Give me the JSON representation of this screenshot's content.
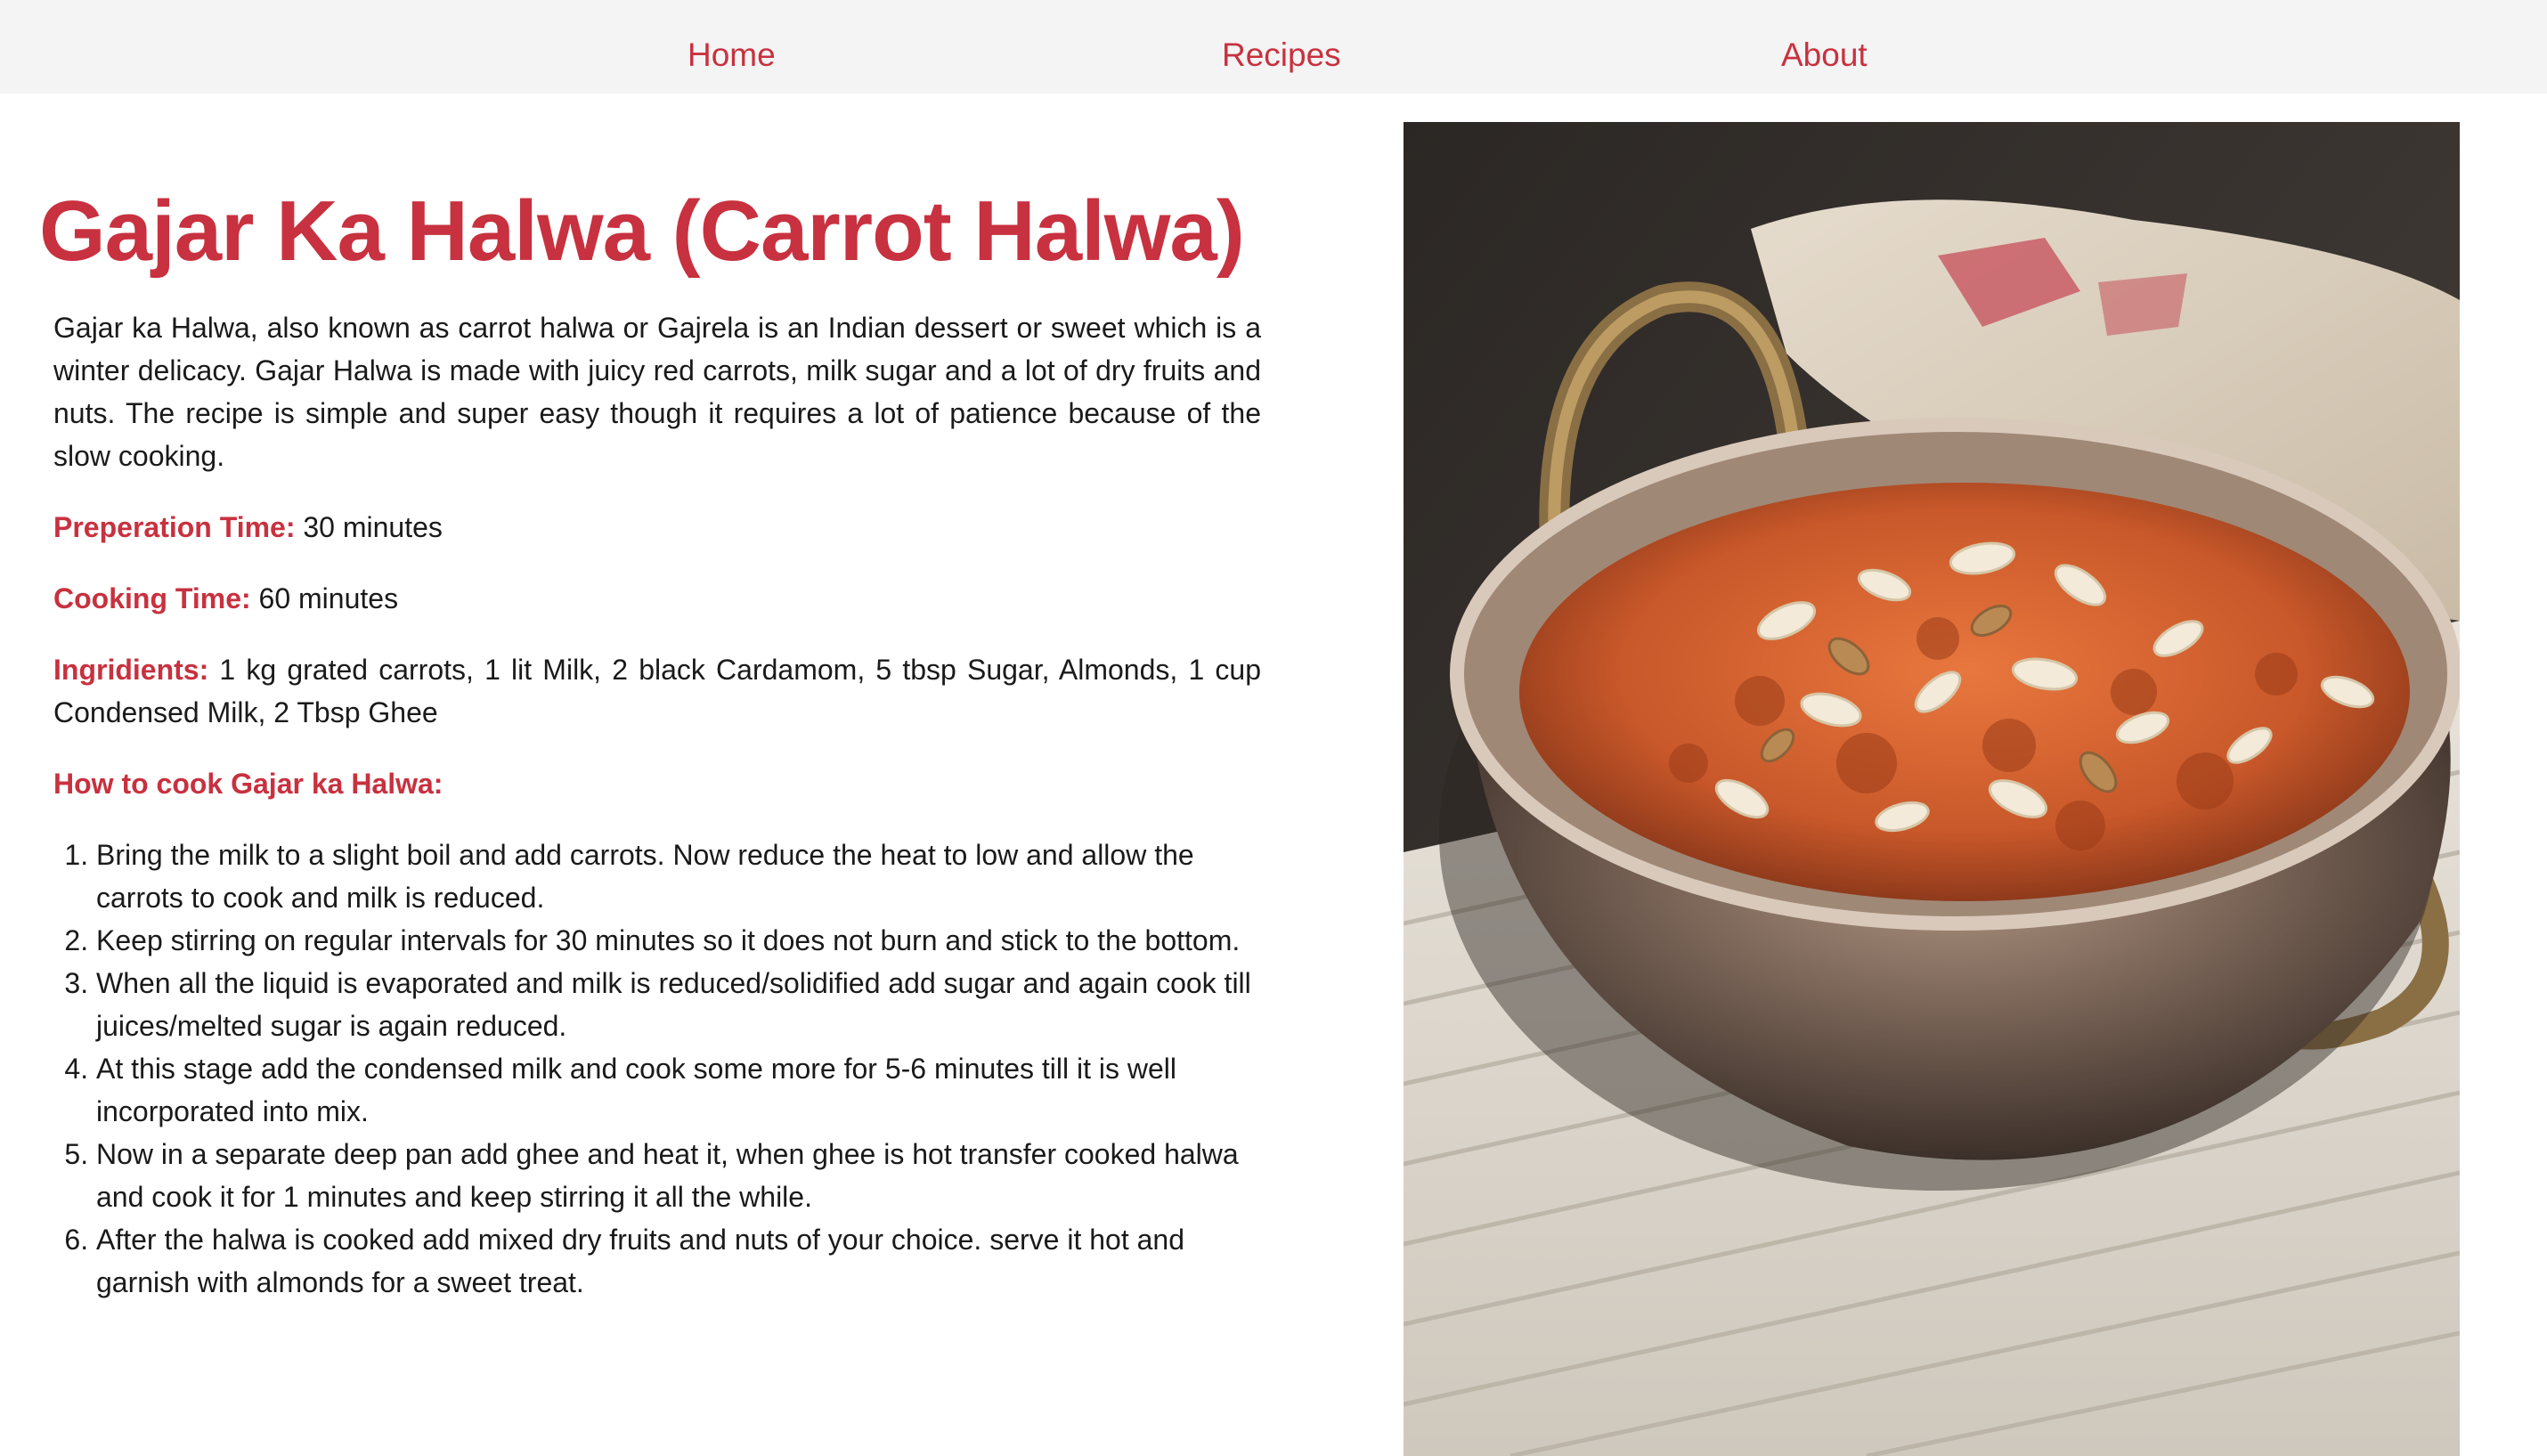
{
  "nav": {
    "home": "Home",
    "recipes": "Recipes",
    "about": "About"
  },
  "recipe": {
    "title": "Gajar Ka Halwa (Carrot Halwa)",
    "intro": "Gajar ka Halwa, also known as carrot halwa or Gajrela is an Indian dessert or sweet which is a winter delicacy. Gajar Halwa is made with juicy red carrots, milk sugar and a lot of dry fruits and nuts. The recipe is simple and super easy though it requires a lot of patience because of the slow cooking.",
    "prep_label": "Preperation Time:",
    "prep_value": "30 minutes",
    "cook_label": "Cooking Time:",
    "cook_value": "60 minutes",
    "ingredients_label": "Ingridients:",
    "ingredients_value": "1 kg grated carrots, 1 lit Milk, 2 black Cardamom, 5 tbsp Sugar, Almonds, 1 cup Condensed Milk, 2 Tbsp Ghee",
    "howto_label": "How to cook Gajar ka Halwa:",
    "steps": [
      "Bring the milk to a slight boil and add carrots. Now reduce the heat to low and allow the carrots to cook and milk is reduced.",
      "Keep stirring on regular intervals for 30 minutes so it does not burn and stick to the bottom.",
      "When all the liquid is evaporated and milk is reduced/solidified add sugar and again cook till juices/melted sugar is again reduced.",
      "At this stage add the condensed milk and cook some more for 5-6 minutes till it is well incorporated into mix.",
      "Now in a separate deep pan add ghee and heat it, when ghee is hot transfer cooked halwa and cook it for 1 minutes and keep stirring it all the while.",
      "After the halwa is cooked add mixed dry fruits and nuts of your choice. serve it hot and garnish with almonds for a sweet treat."
    ]
  },
  "theme": {
    "accent": "#c8313f",
    "nav_background": "#f4f4f4"
  },
  "image": {
    "subject": "carrot-halwa-bowl"
  }
}
